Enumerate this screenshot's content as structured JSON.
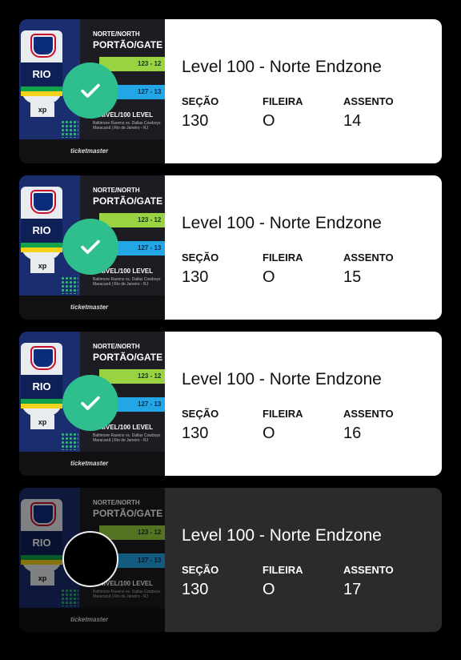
{
  "ticket_art": {
    "gate_top": "NORTE/NORTH",
    "gate_main": "PORTÃO/GATE",
    "shield_text": "RIO",
    "badge": "xp",
    "green_bar": "123 - 12",
    "blue_bar": "127 - 13",
    "level_label": "NÍVEL/100 LEVEL",
    "small_line": "Baltimore Ravens vs. Dallas Cowboys",
    "small_line2": "Maracanã | Rio de Janeiro - RJ",
    "brand": "ticketmaster"
  },
  "colors": {
    "check_green": "#2fbf8f",
    "card_white": "#ffffff",
    "card_dark": "#2b2b2d",
    "background": "#000000"
  },
  "labels": {
    "section": "SEÇÃO",
    "row": "FILEIRA",
    "seat": "ASSENTO"
  },
  "tickets": [
    {
      "title": "Level 100 - Norte Endzone",
      "section": "130",
      "row": "O",
      "seat": "14",
      "status_icon": "check-icon",
      "selected": true
    },
    {
      "title": "Level 100 - Norte Endzone",
      "section": "130",
      "row": "O",
      "seat": "15",
      "status_icon": "check-icon",
      "selected": true
    },
    {
      "title": "Level 100 - Norte Endzone",
      "section": "130",
      "row": "O",
      "seat": "16",
      "status_icon": "check-icon",
      "selected": true
    },
    {
      "title": "Level 100 - Norte Endzone",
      "section": "130",
      "row": "O",
      "seat": "17",
      "status_icon": "empty-circle-icon",
      "selected": false
    }
  ]
}
